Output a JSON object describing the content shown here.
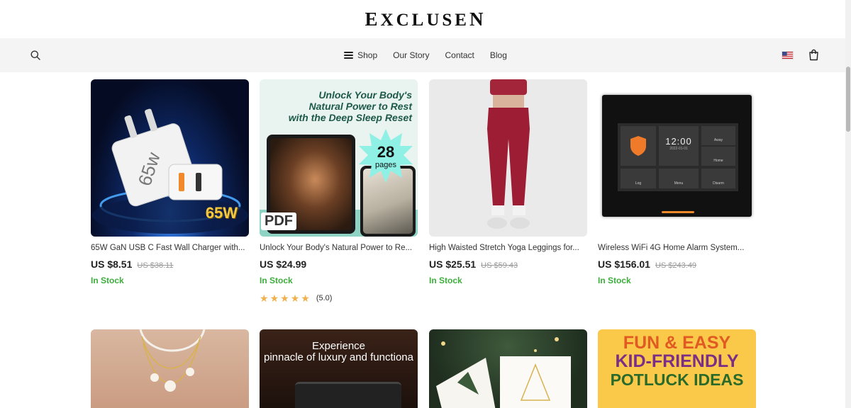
{
  "brand": {
    "logo_first": "E",
    "logo_rest": "XCLUSE",
    "logo_last": "N"
  },
  "nav": {
    "shop": "Shop",
    "our_story": "Our Story",
    "contact": "Contact",
    "blog": "Blog"
  },
  "icons": {
    "search": "search-icon",
    "menu": "hamburger-icon",
    "flag": "us-flag-icon",
    "cart": "shopping-bag-icon"
  },
  "products": [
    {
      "title": "65W GaN USB C Fast Wall Charger with...",
      "price": "US $8.51",
      "old_price": "US $38.11",
      "stock": "In Stock",
      "image": {
        "badge": "65W",
        "label_large": "65w"
      }
    },
    {
      "title": "Unlock Your Body's Natural Power to Re...",
      "price": "US $24.99",
      "stock": "In Stock",
      "rating": "(5.0)",
      "image": {
        "headline_1": "Unlock Your Body's",
        "headline_2": "Natural Power to Rest",
        "headline_3": "with the Deep Sleep Reset",
        "burst_number": "28",
        "burst_text": "pages",
        "pdf": "PDF"
      }
    },
    {
      "title": "High Waisted Stretch Yoga Leggings for...",
      "price": "US $25.51",
      "old_price": "US $59.43",
      "stock": "In Stock"
    },
    {
      "title": "Wireless WiFi 4G Home Alarm System...",
      "price": "US $156.01",
      "old_price": "US $243.49",
      "stock": "In Stock",
      "image": {
        "time": "12:00",
        "date": "2022-01-01",
        "away": "Away",
        "home": "Home",
        "log": "Log",
        "menu": "Menu",
        "disarm": "Disarm"
      }
    }
  ],
  "row2": [
    {
      "alt": "necklace"
    },
    {
      "line_1": "Experience",
      "line_2": "pinnacle of luxury and functiona"
    },
    {
      "alt": "christmas cards"
    },
    {
      "line_1": "FUN & EASY",
      "line_2": "KID-FRIENDLY",
      "line_3": "POTLUCK IDEAS"
    }
  ],
  "colors": {
    "in_stock": "#3cae3c",
    "star": "#f0b14c",
    "nav_bg": "#f4f4f4"
  }
}
